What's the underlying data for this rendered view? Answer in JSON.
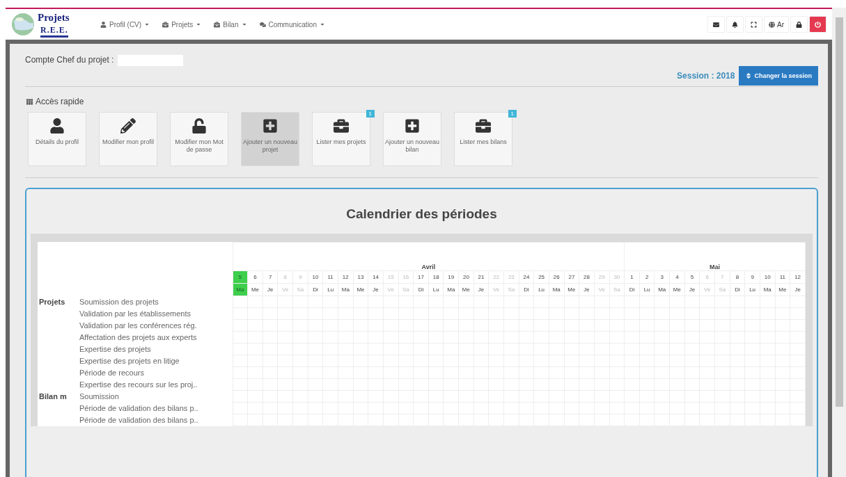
{
  "navbar": {
    "logo": {
      "title": "Projets",
      "subtitle": "R.E.E."
    },
    "menus": [
      {
        "kind": "user",
        "label": "Profil (CV)"
      },
      {
        "kind": "briefcase",
        "label": "Projets"
      },
      {
        "kind": "briefcase",
        "label": "Bilan"
      },
      {
        "kind": "comments",
        "label": "Communication"
      }
    ],
    "tools": [
      {
        "kind": "envelope"
      },
      {
        "kind": "bell"
      },
      {
        "kind": "expand"
      },
      {
        "kind": "globe",
        "label": "Ar"
      },
      {
        "kind": "lock"
      },
      {
        "kind": "power"
      }
    ]
  },
  "account": {
    "label": "Compte Chef du projet :",
    "session": "Session : 2018",
    "session_button": "Changer la session"
  },
  "quick_access": {
    "title": "Accès rapide",
    "items": [
      {
        "kind": "user",
        "label": "Détails du profil",
        "selected": false
      },
      {
        "kind": "pencil",
        "label": "Modifier mon profil",
        "selected": false
      },
      {
        "kind": "unlock",
        "label": "Modifier mon Mot de passe",
        "selected": false
      },
      {
        "kind": "plus",
        "label": "Ajouter un nouveau projet",
        "selected": true
      },
      {
        "kind": "briefcase",
        "label": "Lister mes projets",
        "badge": "1",
        "selected": false
      },
      {
        "kind": "plus",
        "label": "Ajouter un nouveau bilan",
        "selected": false
      },
      {
        "kind": "briefcase",
        "label": "Lister mes bilans",
        "badge": "1",
        "selected": false
      }
    ]
  },
  "calendar": {
    "title": "Calendrier des périodes",
    "months": [
      {
        "name": "Avril",
        "days": [
          {
            "num": "5",
            "wd": "Ma",
            "weekend": false,
            "today": true
          },
          {
            "num": "6",
            "wd": "Me",
            "weekend": false,
            "today": false
          },
          {
            "num": "7",
            "wd": "Je",
            "weekend": false,
            "today": false
          },
          {
            "num": "8",
            "wd": "Ve",
            "weekend": true,
            "today": false
          },
          {
            "num": "9",
            "wd": "Sa",
            "weekend": true,
            "today": false
          },
          {
            "num": "10",
            "wd": "Di",
            "weekend": false,
            "today": false
          },
          {
            "num": "11",
            "wd": "Lu",
            "weekend": false,
            "today": false
          },
          {
            "num": "12",
            "wd": "Ma",
            "weekend": false,
            "today": false
          },
          {
            "num": "13",
            "wd": "Me",
            "weekend": false,
            "today": false
          },
          {
            "num": "14",
            "wd": "Je",
            "weekend": false,
            "today": false
          },
          {
            "num": "15",
            "wd": "Ve",
            "weekend": true,
            "today": false
          },
          {
            "num": "16",
            "wd": "Sa",
            "weekend": true,
            "today": false
          },
          {
            "num": "17",
            "wd": "Di",
            "weekend": false,
            "today": false
          },
          {
            "num": "18",
            "wd": "Lu",
            "weekend": false,
            "today": false
          },
          {
            "num": "19",
            "wd": "Ma",
            "weekend": false,
            "today": false
          },
          {
            "num": "20",
            "wd": "Me",
            "weekend": false,
            "today": false
          },
          {
            "num": "21",
            "wd": "Je",
            "weekend": false,
            "today": false
          },
          {
            "num": "22",
            "wd": "Ve",
            "weekend": true,
            "today": false
          },
          {
            "num": "23",
            "wd": "Sa",
            "weekend": true,
            "today": false
          },
          {
            "num": "24",
            "wd": "Di",
            "weekend": false,
            "today": false
          },
          {
            "num": "25",
            "wd": "Lu",
            "weekend": false,
            "today": false
          },
          {
            "num": "26",
            "wd": "Ma",
            "weekend": false,
            "today": false
          },
          {
            "num": "27",
            "wd": "Me",
            "weekend": false,
            "today": false
          },
          {
            "num": "28",
            "wd": "Je",
            "weekend": false,
            "today": false
          },
          {
            "num": "29",
            "wd": "Ve",
            "weekend": true,
            "today": false
          },
          {
            "num": "30",
            "wd": "Sa",
            "weekend": true,
            "today": false
          }
        ]
      },
      {
        "name": "Mai",
        "days": [
          {
            "num": "1",
            "wd": "Di",
            "weekend": false,
            "today": false
          },
          {
            "num": "2",
            "wd": "Lu",
            "weekend": false,
            "today": false
          },
          {
            "num": "3",
            "wd": "Ma",
            "weekend": false,
            "today": false
          },
          {
            "num": "4",
            "wd": "Me",
            "weekend": false,
            "today": false
          },
          {
            "num": "5",
            "wd": "Je",
            "weekend": false,
            "today": false
          },
          {
            "num": "6",
            "wd": "Ve",
            "weekend": true,
            "today": false
          },
          {
            "num": "7",
            "wd": "Sa",
            "weekend": true,
            "today": false
          },
          {
            "num": "8",
            "wd": "Di",
            "weekend": false,
            "today": false
          },
          {
            "num": "9",
            "wd": "Lu",
            "weekend": false,
            "today": false
          },
          {
            "num": "10",
            "wd": "Ma",
            "weekend": false,
            "today": false
          },
          {
            "num": "11",
            "wd": "Me",
            "weekend": false,
            "today": false
          },
          {
            "num": "12",
            "wd": "Je",
            "weekend": false,
            "today": false
          }
        ]
      }
    ],
    "groups": [
      {
        "label": "Projets",
        "items": [
          "Soumission des projets",
          "Validation par les établissements",
          "Validation par les conférences rég.",
          "Affectation des projets aux experts",
          "Expertise des projets",
          "Expertise des projets en litige",
          "Période de recours",
          "Expertise des recours sur les proj.."
        ]
      },
      {
        "label": "Bilan m",
        "items": [
          "Soumission",
          "Période de validation des bilans p..",
          "Période de validation des bilans p.."
        ]
      }
    ]
  }
}
